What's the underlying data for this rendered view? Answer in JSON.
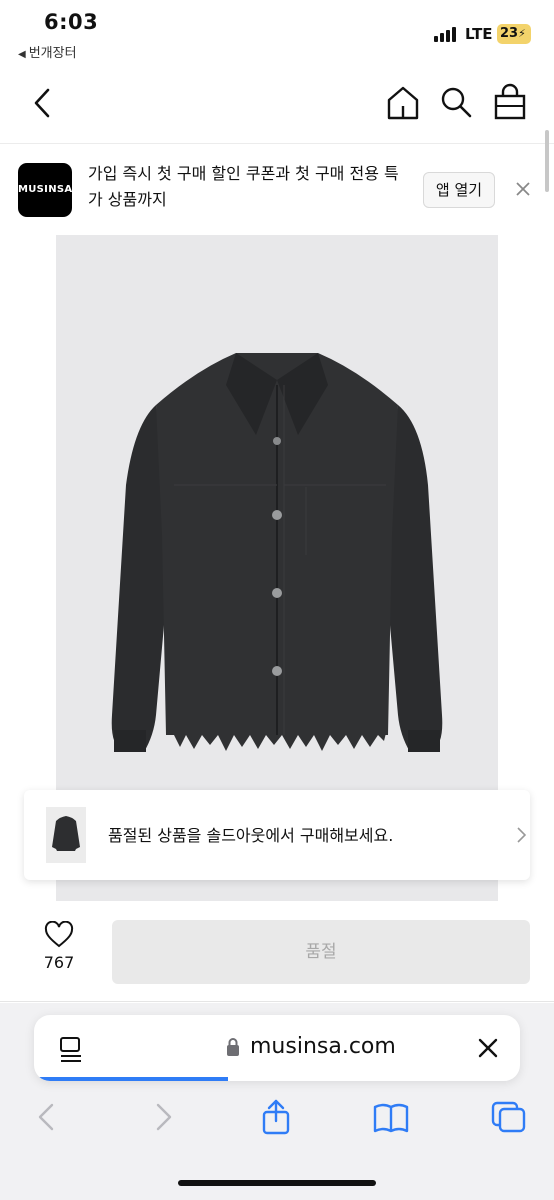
{
  "status_bar": {
    "time": "6:03",
    "back_app": "번개장터",
    "network": "LTE",
    "battery": "23"
  },
  "nav": {
    "icons": [
      "chevron-left-icon",
      "home-icon",
      "search-icon",
      "shopping-bag-icon"
    ]
  },
  "app_banner": {
    "logo_text": "MUSINSA",
    "message": "가입 즉시 첫 구매 할인 쿠폰과 첫 구매 전용 특가 상품까지",
    "open_app_label": "앱 열기"
  },
  "soldout_card": {
    "text": "품절된 상품을 솔드아웃에서 구매해보세요."
  },
  "action_bar": {
    "like_count": "767",
    "buy_button_label": "품절"
  },
  "browser": {
    "url": "musinsa.com",
    "load_progress": 0.4
  },
  "colors": {
    "accent_blue": "#2f7cf6",
    "disabled_button": "#e9e9e9",
    "product_background": "#e8e8ea"
  }
}
